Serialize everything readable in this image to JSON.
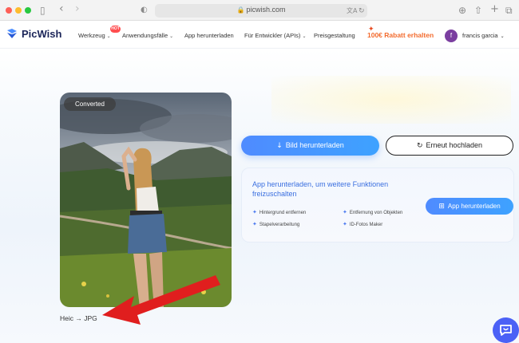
{
  "browser": {
    "url": "picwish.com",
    "icons": [
      "sidebar-toggle-icon",
      "back-icon",
      "forward-icon",
      "shield-icon",
      "translate-icon",
      "reload-icon",
      "download-icon",
      "share-icon",
      "new-tab-icon",
      "tabs-overview-icon"
    ]
  },
  "nav": {
    "brand": "PicWish",
    "hot_badge": "HOT",
    "items": [
      {
        "label": "Werkzeug",
        "caret": "⌄"
      },
      {
        "label": "Anwendungsfälle",
        "caret": "⌄"
      },
      {
        "label": "App herunterladen",
        "caret": ""
      },
      {
        "label": "Für Entwickler (APIs)",
        "caret": "⌄"
      },
      {
        "label": "Preisgestaltung",
        "caret": ""
      }
    ],
    "promo": "100€ Rabatt erhalten",
    "user_initial": "f",
    "user_name": "francis garcia",
    "user_caret": "⌄"
  },
  "result": {
    "badge": "Converted",
    "caption": "Heic → JPG"
  },
  "actions": {
    "download_label": "Bild herunterladen",
    "reupload_label": "Erneut hochladen"
  },
  "app_card": {
    "title": "App herunterladen, um weitere Funktionen freizuschalten",
    "features": [
      "Hintergrund entfernen",
      "Entfernung von Objekten",
      "Stapelverarbeitung",
      "ID-Fotos Maker"
    ],
    "button_label": "App herunterladen"
  },
  "colors": {
    "accent": "#4f8bff",
    "promo": "#f36b2e",
    "annotation_arrow": "#e01e1e",
    "chat": "#4b61f6"
  }
}
